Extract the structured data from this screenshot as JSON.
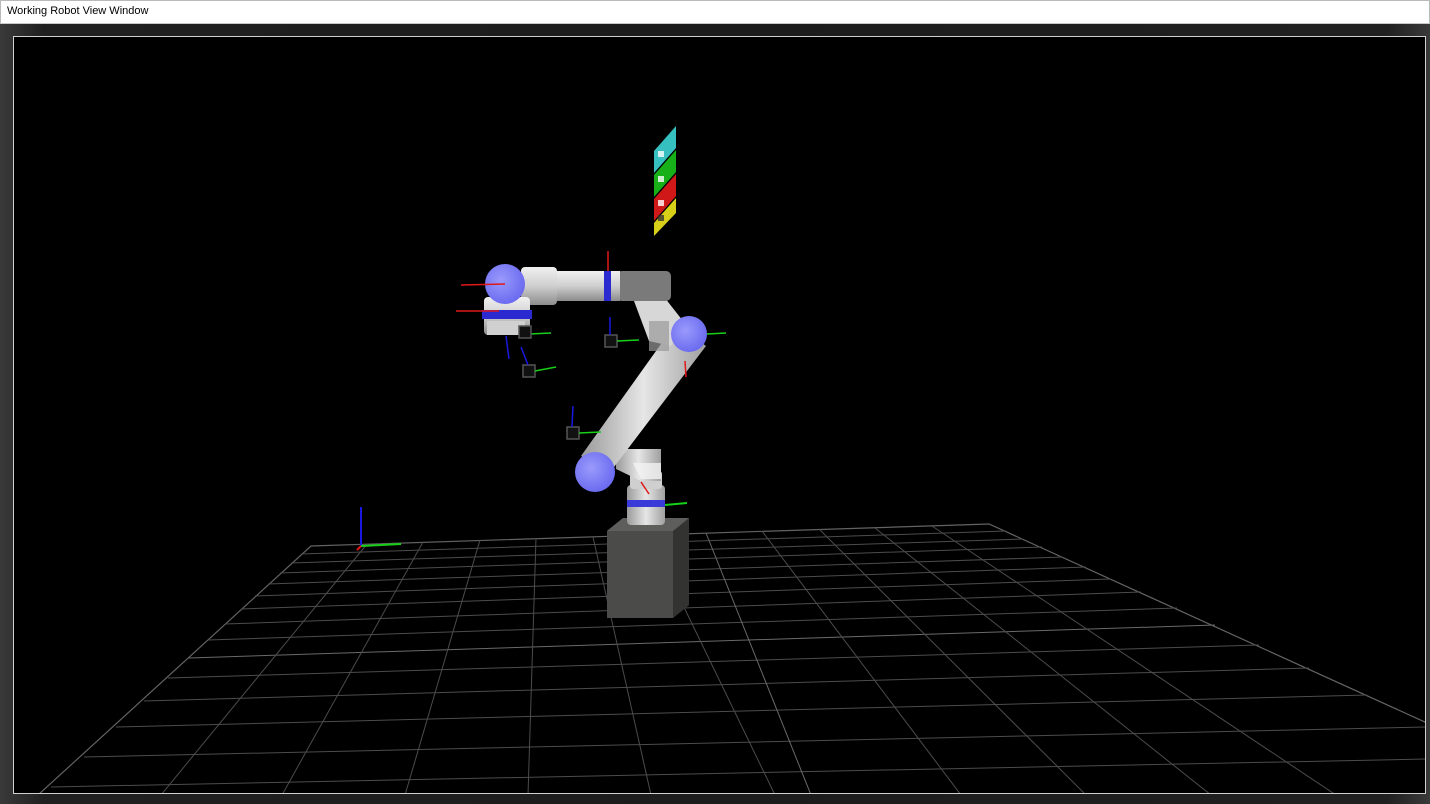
{
  "window": {
    "title": "Working Robot View Window"
  },
  "viewport": {
    "background_color": "#000000",
    "grid_color": "#8a8a8a",
    "joint_color": "#7b7bf5",
    "link_color": "#d9d9d9",
    "axis_colors": {
      "x": "#e01818",
      "y": "#18d018",
      "z": "#1818e0"
    },
    "status_panels": [
      "#36c0c0",
      "#18b018",
      "#d01818",
      "#d8d018"
    ]
  }
}
